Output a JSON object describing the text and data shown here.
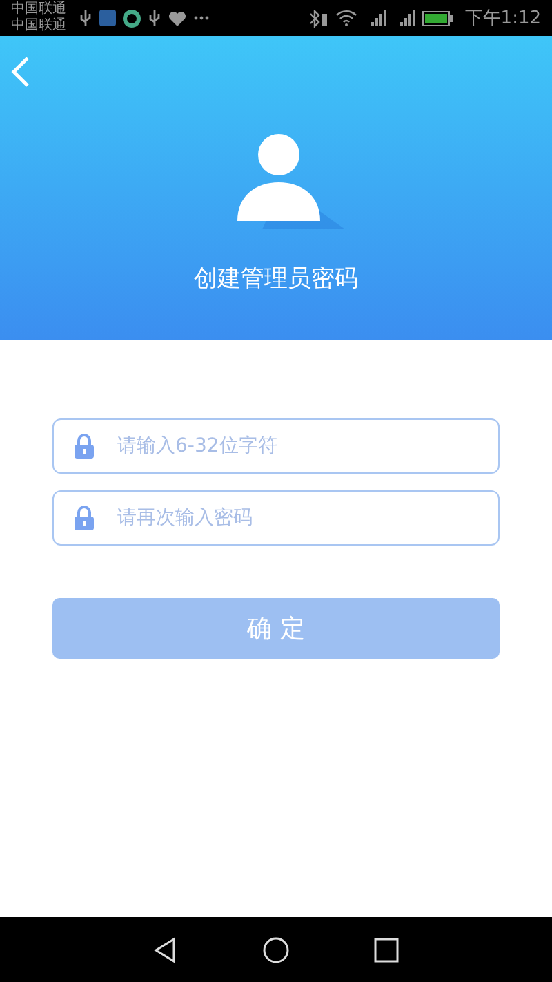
{
  "status_bar": {
    "carriers": [
      "中国联通",
      "中国联通"
    ],
    "time": "下午1:12"
  },
  "header": {
    "title": "创建管理员密码"
  },
  "fields": [
    {
      "placeholder": "请输入6-32位字符"
    },
    {
      "placeholder": "请再次输入密码"
    }
  ],
  "confirm_button": {
    "label": "确 定",
    "disabled": true
  }
}
